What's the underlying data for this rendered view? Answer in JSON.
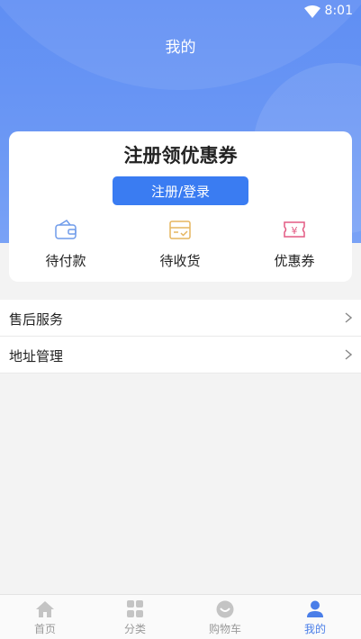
{
  "status_bar": {
    "time": "8:01",
    "wifi_icon": "wifi-icon"
  },
  "header": {
    "title": "我的"
  },
  "card": {
    "title": "注册领优惠券",
    "register_button": "注册/登录",
    "shortcuts": [
      {
        "label": "待付款",
        "icon": "wallet-icon",
        "color": "#6f9bea"
      },
      {
        "label": "待收货",
        "icon": "box-icon",
        "color": "#e6b55e"
      },
      {
        "label": "优惠券",
        "icon": "coupon-icon",
        "color": "#e35a83"
      }
    ]
  },
  "menu": {
    "items": [
      {
        "label": "售后服务"
      },
      {
        "label": "地址管理"
      }
    ]
  },
  "tabbar": {
    "items": [
      {
        "label": "首页",
        "icon": "home-icon",
        "active": false
      },
      {
        "label": "分类",
        "icon": "grid-icon",
        "active": false
      },
      {
        "label": "购物车",
        "icon": "cart-icon",
        "active": false
      },
      {
        "label": "我的",
        "icon": "user-icon",
        "active": true
      }
    ],
    "active_color": "#4a7ee8",
    "inactive_color": "#c4c4c4"
  },
  "colors": {
    "accent": "#3a7cf2",
    "header": "#6c98f4"
  }
}
